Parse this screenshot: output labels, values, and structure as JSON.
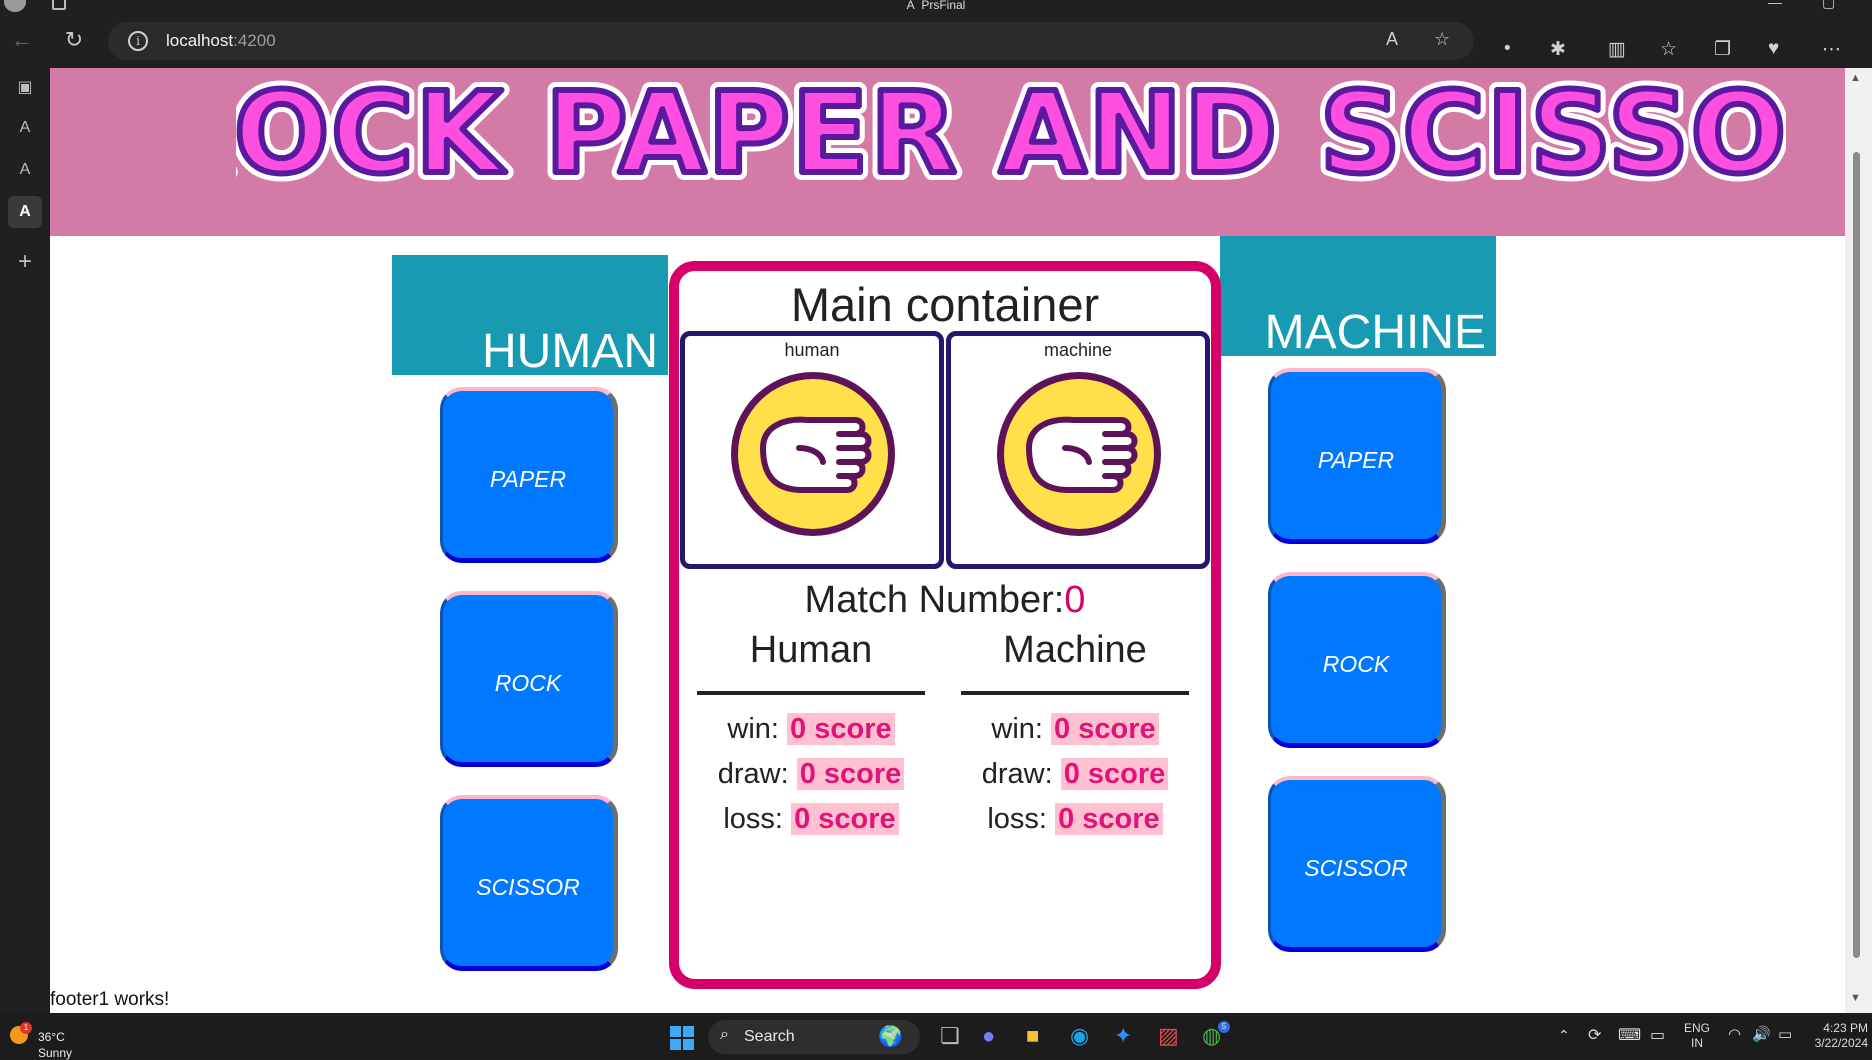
{
  "browser": {
    "window_title": "PrsFinal",
    "url_host": "localhost",
    "url_port": ":4200"
  },
  "page": {
    "logo_text": "ROCK PAPER AND SCISSOR",
    "human_header": "HUMAN",
    "machine_header": "MACHINE",
    "human_buttons": [
      "PAPER",
      "ROCK",
      "SCISSOR"
    ],
    "machine_buttons": [
      "PAPER",
      "ROCK",
      "SCISSOR"
    ],
    "main": {
      "title": "Main container",
      "human_label": "human",
      "machine_label": "machine",
      "match_label": "Match Number:",
      "match_number": "0",
      "human_col": "Human",
      "machine_col": "Machine",
      "human_scores": {
        "win_label": "win:",
        "win": "0 score",
        "draw_label": "draw:",
        "draw": "0 score",
        "loss_label": "loss:",
        "loss": "0 score"
      },
      "machine_scores": {
        "win_label": "win:",
        "win": "0 score",
        "draw_label": "draw:",
        "draw": "0 score",
        "loss_label": "loss:",
        "loss": "0 score"
      }
    },
    "footer": "footer1 works!"
  },
  "taskbar": {
    "weather_temp": "36°C",
    "weather_desc": "Sunny",
    "weather_badge": "1",
    "search_placeholder": "Search",
    "lang": "ENG",
    "region": "IN",
    "time": "4:23 PM",
    "date": "3/22/2024",
    "chrome_badge": "5"
  },
  "colors": {
    "header_bg": "#d47aa6",
    "teal": "#179ab2",
    "button_blue": "#0078ff",
    "main_border": "#d6006b",
    "score_bg": "#ffc0d0"
  }
}
